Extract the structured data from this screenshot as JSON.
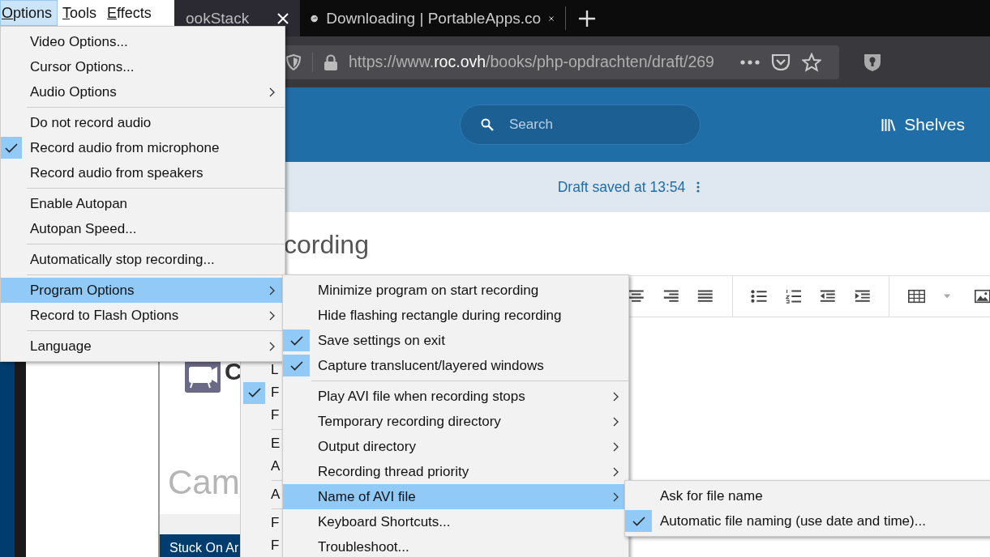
{
  "app_menubar": [
    {
      "label": "Options",
      "selected": true
    },
    {
      "label": "Tools",
      "selected": false
    },
    {
      "label": "Effects",
      "selected": false
    }
  ],
  "browser": {
    "tabs": [
      {
        "label": "ookStack",
        "selected": true,
        "kind": "page"
      },
      {
        "label": "Downloading | PortableApps.co",
        "selected": false,
        "kind": "download"
      }
    ],
    "url": "https://www.**roc.ovh**/books/php-opdrachten/draft/269"
  },
  "page": {
    "search_placeholder": "Search",
    "shelves": "Shelves",
    "draft_status": "Draft saved at 13:54",
    "title": "cording"
  },
  "background_window": {
    "title_letter": "C",
    "logo_text": "Cam",
    "taskbar_label": "Stuck On Ar"
  },
  "hidden_menu": {
    "items": [
      {
        "kind": "item",
        "label": "L",
        "checked": false
      },
      {
        "kind": "item",
        "label": "F",
        "checked": true
      },
      {
        "kind": "item",
        "label": "F",
        "checked": false
      },
      {
        "kind": "separator"
      },
      {
        "kind": "item",
        "label": "E",
        "checked": false
      },
      {
        "kind": "item",
        "label": "A",
        "checked": false
      },
      {
        "kind": "separator"
      },
      {
        "kind": "item",
        "label": "A",
        "checked": false
      },
      {
        "kind": "separator"
      },
      {
        "kind": "item",
        "label": "F",
        "checked": false
      },
      {
        "kind": "item",
        "label": "F",
        "checked": false
      }
    ]
  },
  "options_menu": {
    "items": [
      {
        "kind": "item",
        "label": "Video Options...",
        "checked": false,
        "selected": false,
        "submenu": false
      },
      {
        "kind": "item",
        "label": "Cursor Options...",
        "checked": false,
        "selected": false,
        "submenu": false
      },
      {
        "kind": "item",
        "label": "Audio Options",
        "checked": false,
        "selected": false,
        "submenu": true
      },
      {
        "kind": "separator"
      },
      {
        "kind": "item",
        "label": "Do not record audio",
        "checked": false,
        "selected": false,
        "submenu": false
      },
      {
        "kind": "item",
        "label": "Record audio from microphone",
        "checked": true,
        "selected": false,
        "submenu": false
      },
      {
        "kind": "item",
        "label": "Record audio from speakers",
        "checked": false,
        "selected": false,
        "submenu": false
      },
      {
        "kind": "separator"
      },
      {
        "kind": "item",
        "label": "Enable Autopan",
        "checked": false,
        "selected": false,
        "submenu": false
      },
      {
        "kind": "item",
        "label": "Autopan Speed...",
        "checked": false,
        "selected": false,
        "submenu": false
      },
      {
        "kind": "separator"
      },
      {
        "kind": "item",
        "label": "Automatically stop recording...",
        "checked": false,
        "selected": false,
        "submenu": false
      },
      {
        "kind": "separator"
      },
      {
        "kind": "item",
        "label": "Program Options",
        "checked": false,
        "selected": true,
        "submenu": true
      },
      {
        "kind": "item",
        "label": "Record to Flash Options",
        "checked": false,
        "selected": false,
        "submenu": true
      },
      {
        "kind": "separator"
      },
      {
        "kind": "item",
        "label": "Language",
        "checked": false,
        "selected": false,
        "submenu": true
      }
    ]
  },
  "program_options_menu": {
    "items": [
      {
        "kind": "item",
        "label": "Minimize program on start recording",
        "checked": false,
        "selected": false,
        "submenu": false
      },
      {
        "kind": "item",
        "label": "Hide flashing rectangle during recording",
        "checked": false,
        "selected": false,
        "submenu": false
      },
      {
        "kind": "item",
        "label": "Save settings on exit",
        "checked": true,
        "selected": false,
        "submenu": false
      },
      {
        "kind": "item",
        "label": "Capture translucent/layered windows",
        "checked": true,
        "selected": false,
        "submenu": false
      },
      {
        "kind": "separator"
      },
      {
        "kind": "item",
        "label": "Play AVI file when recording stops",
        "checked": false,
        "selected": false,
        "submenu": true
      },
      {
        "kind": "item",
        "label": "Temporary recording directory",
        "checked": false,
        "selected": false,
        "submenu": true
      },
      {
        "kind": "item",
        "label": "Output directory",
        "checked": false,
        "selected": false,
        "submenu": true
      },
      {
        "kind": "item",
        "label": "Recording thread priority",
        "checked": false,
        "selected": false,
        "submenu": true
      },
      {
        "kind": "item",
        "label": "Name of AVI file",
        "checked": false,
        "selected": true,
        "submenu": true
      },
      {
        "kind": "item",
        "label": "Keyboard Shortcuts...",
        "checked": false,
        "selected": false,
        "submenu": false
      },
      {
        "kind": "item",
        "label": "Troubleshoot...",
        "checked": false,
        "selected": false,
        "submenu": false
      }
    ]
  },
  "avi_name_menu": {
    "items": [
      {
        "kind": "item",
        "label": "Ask for file name",
        "checked": false,
        "selected": false,
        "submenu": false
      },
      {
        "kind": "item",
        "label": "Automatic file naming (use date and time)...",
        "checked": true,
        "selected": false,
        "submenu": false
      }
    ]
  }
}
